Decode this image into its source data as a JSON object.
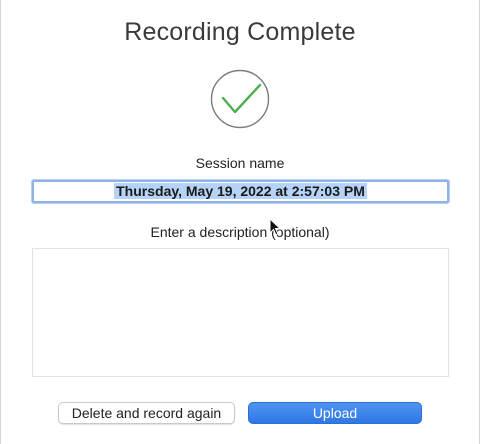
{
  "dialog": {
    "title": "Recording Complete",
    "status_icon": "checkmark-circle-icon",
    "session_label": "Session name",
    "session_value": "Thursday, May 19, 2022 at 2:57:03 PM",
    "description_label": "Enter a description (optional)",
    "description_value": "",
    "delete_button_label": "Delete and record again",
    "upload_button_label": "Upload"
  },
  "colors": {
    "check": "#4caf50",
    "primary_button": "#3a83ea",
    "selection": "#b5d2f7"
  }
}
